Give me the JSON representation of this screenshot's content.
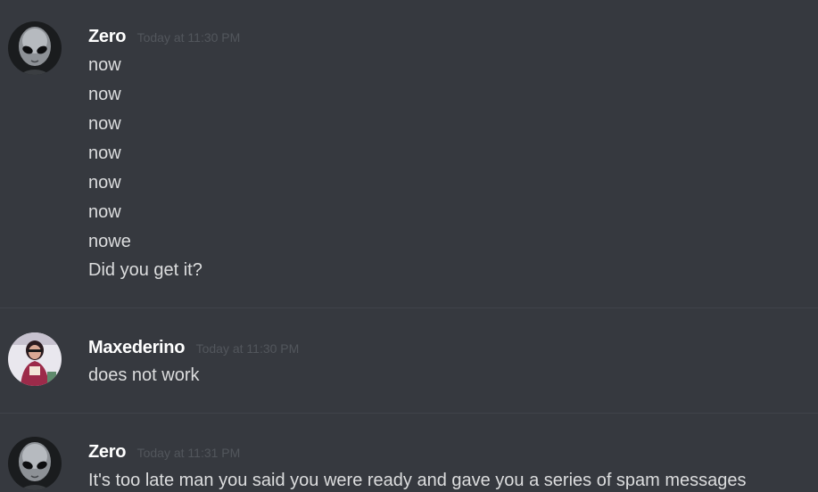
{
  "messages": [
    {
      "username": "Zero",
      "timestamp": "Today at 11:30 PM",
      "avatar_icon": "alien-avatar-icon",
      "lines": [
        "now",
        "now",
        "now",
        "now",
        "now",
        "now",
        "nowe",
        "Did you get it?"
      ]
    },
    {
      "username": "Maxederino",
      "timestamp": "Today at 11:30 PM",
      "avatar_icon": "user-photo-avatar-icon",
      "lines": [
        "does not work"
      ]
    },
    {
      "username": "Zero",
      "timestamp": "Today at 11:31 PM",
      "avatar_icon": "alien-avatar-icon",
      "lines": [
        "It's too late man you said you were ready and gave you a series of spam messages"
      ]
    }
  ],
  "colors": {
    "background": "#36393f",
    "username": "#ffffff",
    "message_text": "#dcddde",
    "timestamp": "#52565c",
    "divider": "#40434a"
  }
}
